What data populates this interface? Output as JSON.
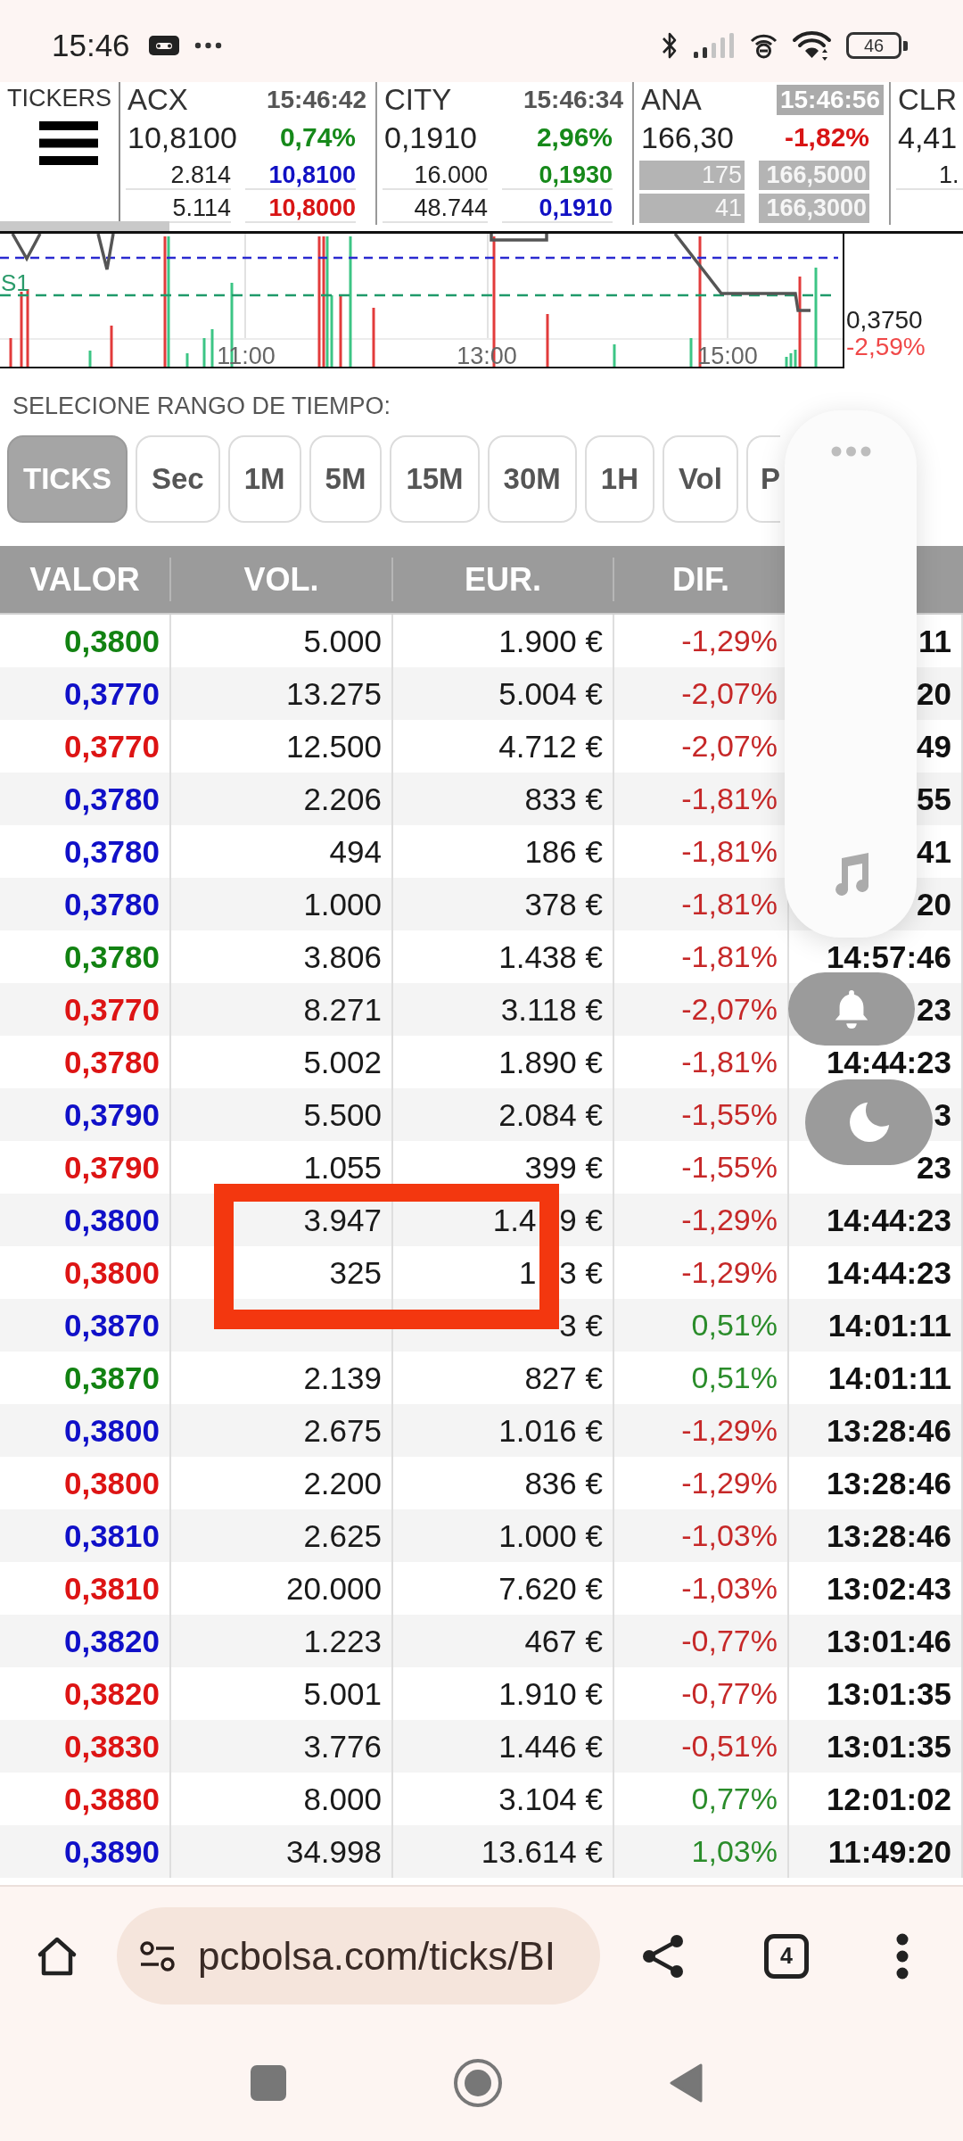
{
  "status_bar": {
    "time": "15:46",
    "battery": "46"
  },
  "tickers_menu": {
    "label": "TICKERS"
  },
  "tickers": [
    {
      "symbol": "ACX",
      "time": "15:46:42",
      "time_highlighted": false,
      "price": "10,8100",
      "change": {
        "text": "0,74%",
        "color": "#16891a"
      },
      "cut": false,
      "book": [
        {
          "qty": "2.814",
          "price": "10,8100",
          "color": "#1111c4",
          "highlighted": false
        },
        {
          "qty": "5.114",
          "price": "10,8000",
          "color": "#d81515",
          "highlighted": false
        }
      ]
    },
    {
      "symbol": "CITY",
      "time": "15:46:34",
      "time_highlighted": false,
      "price": "0,1910",
      "change": {
        "text": "2,96%",
        "color": "#16891a"
      },
      "cut": false,
      "book": [
        {
          "qty": "16.000",
          "price": "0,1930",
          "color": "#16891a",
          "highlighted": false
        },
        {
          "qty": "48.744",
          "price": "0,1910",
          "color": "#1111c4",
          "highlighted": false
        }
      ]
    },
    {
      "symbol": "ANA",
      "time": "15:46:56",
      "time_highlighted": true,
      "price": "166,30",
      "change": {
        "text": "-1,82%",
        "color": "#d81515"
      },
      "cut": false,
      "book": [
        {
          "qty": "175",
          "price": "166,5000",
          "highlighted": true
        },
        {
          "qty": "41",
          "price": "166,3000",
          "highlighted": true
        }
      ]
    },
    {
      "symbol": "CLR",
      "price": "4,41",
      "cut": true,
      "book": [
        {
          "qty": "1.",
          "highlighted": false
        }
      ]
    }
  ],
  "chart": {
    "level_label": "S1",
    "time_labels": [
      "11:00",
      "13:00",
      "15:00"
    ],
    "last_price": "0,3750",
    "last_change": "-2,59%"
  },
  "time_range": {
    "label": "SELECIONE RANGO DE TIEMPO:",
    "buttons": [
      {
        "label": "TICKS",
        "selected": true
      },
      {
        "label": "Sec",
        "selected": false
      },
      {
        "label": "1M",
        "selected": false
      },
      {
        "label": "5M",
        "selected": false
      },
      {
        "label": "15M",
        "selected": false
      },
      {
        "label": "30M",
        "selected": false
      },
      {
        "label": "1H",
        "selected": false
      },
      {
        "label": "Vol",
        "selected": false
      },
      {
        "label": "P",
        "selected": false
      }
    ]
  },
  "table": {
    "columns": [
      "VALOR",
      "VOL.",
      "EUR.",
      "DIF."
    ],
    "rows": [
      {
        "valor": "0,3800",
        "color": "#128212",
        "vol": "5.000",
        "eur": "1.900 €",
        "dif": {
          "text": "-1,29%",
          "color": "#c62828"
        },
        "hora": "11"
      },
      {
        "valor": "0,3770",
        "color": "#1010c8",
        "vol": "13.275",
        "eur": "5.004 €",
        "dif": {
          "text": "-2,07%",
          "color": "#c62828"
        },
        "hora": "20"
      },
      {
        "valor": "0,3770",
        "color": "#dd1414",
        "vol": "12.500",
        "eur": "4.712 €",
        "dif": {
          "text": "-2,07%",
          "color": "#c62828"
        },
        "hora": "49"
      },
      {
        "valor": "0,3780",
        "color": "#1010c8",
        "vol": "2.206",
        "eur": "833 €",
        "dif": {
          "text": "-1,81%",
          "color": "#c62828"
        },
        "hora": "55"
      },
      {
        "valor": "0,3780",
        "color": "#1010c8",
        "vol": "494",
        "eur": "186 €",
        "dif": {
          "text": "-1,81%",
          "color": "#c62828"
        },
        "hora": "41"
      },
      {
        "valor": "0,3780",
        "color": "#1010c8",
        "vol": "1.000",
        "eur": "378 €",
        "dif": {
          "text": "-1,81%",
          "color": "#c62828"
        },
        "hora": "20"
      },
      {
        "valor": "0,3780",
        "color": "#128212",
        "vol": "3.806",
        "eur": "1.438 €",
        "dif": {
          "text": "-1,81%",
          "color": "#c62828"
        },
        "hora": "14:57:46"
      },
      {
        "valor": "0,3770",
        "color": "#dd1414",
        "vol": "8.271",
        "eur": "3.118 €",
        "dif": {
          "text": "-2,07%",
          "color": "#c62828"
        },
        "hora": "23"
      },
      {
        "valor": "0,3780",
        "color": "#dd1414",
        "vol": "5.002",
        "eur": "1.890 €",
        "dif": {
          "text": "-1,81%",
          "color": "#c62828"
        },
        "hora": "14:44:23"
      },
      {
        "valor": "0,3790",
        "color": "#1010c8",
        "vol": "5.500",
        "eur": "2.084 €",
        "dif": {
          "text": "-1,55%",
          "color": "#c62828"
        },
        "hora": "3"
      },
      {
        "valor": "0,3790",
        "color": "#dd1414",
        "vol": "1.055",
        "eur": "399 €",
        "dif": {
          "text": "-1,55%",
          "color": "#c62828"
        },
        "hora": "23"
      },
      {
        "valor": "0,3800",
        "color": "#1010c8",
        "vol": "3.947",
        "eur_parts": [
          "1.4",
          "9 €"
        ],
        "dif": {
          "text": "-1,29%",
          "color": "#c62828"
        },
        "hora": "14:44:23"
      },
      {
        "valor": "0,3800",
        "color": "#dd1414",
        "vol": "325",
        "eur_parts": [
          "1",
          "3 €"
        ],
        "dif": {
          "text": "-1,29%",
          "color": "#c62828"
        },
        "hora": "14:44:23"
      },
      {
        "valor": "0,3870",
        "color": "#1010c8",
        "eur": "3 €",
        "dif": {
          "text": "0,51%",
          "color": "#2a8c2a"
        },
        "hora": "14:01:11"
      },
      {
        "valor": "0,3870",
        "color": "#128212",
        "vol": "2.139",
        "eur": "827 €",
        "dif": {
          "text": "0,51%",
          "color": "#2a8c2a"
        },
        "hora": "14:01:11"
      },
      {
        "valor": "0,3800",
        "color": "#1010c8",
        "vol": "2.675",
        "eur": "1.016 €",
        "dif": {
          "text": "-1,29%",
          "color": "#c62828"
        },
        "hora": "13:28:46"
      },
      {
        "valor": "0,3800",
        "color": "#dd1414",
        "vol": "2.200",
        "eur": "836 €",
        "dif": {
          "text": "-1,29%",
          "color": "#c62828"
        },
        "hora": "13:28:46"
      },
      {
        "valor": "0,3810",
        "color": "#1010c8",
        "vol": "2.625",
        "eur": "1.000 €",
        "dif": {
          "text": "-1,03%",
          "color": "#c62828"
        },
        "hora": "13:28:46"
      },
      {
        "valor": "0,3810",
        "color": "#dd1414",
        "vol": "20.000",
        "eur": "7.620 €",
        "dif": {
          "text": "-1,03%",
          "color": "#c62828"
        },
        "hora": "13:02:43"
      },
      {
        "valor": "0,3820",
        "color": "#1010c8",
        "vol": "1.223",
        "eur": "467 €",
        "dif": {
          "text": "-0,77%",
          "color": "#c62828"
        },
        "hora": "13:01:46"
      },
      {
        "valor": "0,3820",
        "color": "#dd1414",
        "vol": "5.001",
        "eur": "1.910 €",
        "dif": {
          "text": "-0,77%",
          "color": "#c62828"
        },
        "hora": "13:01:35"
      },
      {
        "valor": "0,3830",
        "color": "#dd1414",
        "vol": "3.776",
        "eur": "1.446 €",
        "dif": {
          "text": "-0,51%",
          "color": "#c62828"
        },
        "hora": "13:01:35"
      },
      {
        "valor": "0,3880",
        "color": "#dd1414",
        "vol": "8.000",
        "eur": "3.104 €",
        "dif": {
          "text": "0,77%",
          "color": "#2a8c2a"
        },
        "hora": "12:01:02"
      },
      {
        "valor": "0,3890",
        "color": "#1010c8",
        "vol": "34.998",
        "eur": "13.614 €",
        "dif": {
          "text": "1,03%",
          "color": "#2a8c2a"
        },
        "hora": "11:49:20"
      }
    ]
  },
  "annotation": {
    "kind": "rectangle"
  },
  "browser": {
    "url": "pcbolsa.com/ticks/BI",
    "tab_count": "4"
  }
}
